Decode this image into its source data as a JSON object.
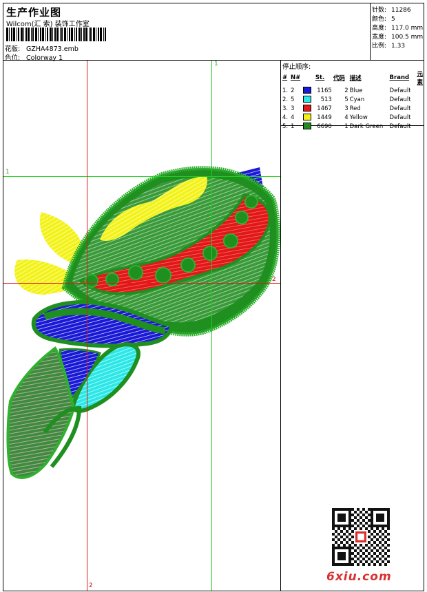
{
  "header": {
    "title": "生产作业图",
    "subtitle": "Wilcom(汇 索) 装饰工作室",
    "design_label": "花版:",
    "design_value": "GZHA4873.emb",
    "colorway_label": "色位:",
    "colorway_value": "Colorway 1"
  },
  "stats": [
    {
      "label": "针数:",
      "value": "11286"
    },
    {
      "label": "颜色:",
      "value": "5"
    },
    {
      "label": "高度:",
      "value": "117.0 mm"
    },
    {
      "label": "宽度:",
      "value": "100.5 mm"
    },
    {
      "label": "比例:",
      "value": "1.33"
    }
  ],
  "sequence": {
    "title": "停止顺序:",
    "headers": [
      "#",
      "N#",
      "",
      "St.",
      "代码",
      "描述",
      "Brand",
      "元素"
    ],
    "rows": [
      {
        "num": "1.",
        "n": "2",
        "color": "#1a1ad6",
        "stitches": "1165",
        "code": "2",
        "desc": "Blue",
        "brand": "Default"
      },
      {
        "num": "2.",
        "n": "5",
        "color": "#2ee6e6",
        "stitches": "513",
        "code": "5",
        "desc": "Cyan",
        "brand": "Default"
      },
      {
        "num": "3.",
        "n": "3",
        "color": "#e01818",
        "stitches": "1467",
        "code": "3",
        "desc": "Red",
        "brand": "Default"
      },
      {
        "num": "4.",
        "n": "4",
        "color": "#f2f21a",
        "stitches": "1449",
        "code": "4",
        "desc": "Yellow",
        "brand": "Default"
      },
      {
        "num": "5.",
        "n": "1",
        "color": "#1e8c1e",
        "stitches": "6690",
        "code": "1",
        "desc": "Dark Green",
        "brand": "Default"
      }
    ]
  },
  "guides": {
    "v1_label": "1",
    "h1_label": "1",
    "h2_label": "2",
    "v2_label": "2"
  },
  "watermark": {
    "brand": "6xiu.com"
  }
}
